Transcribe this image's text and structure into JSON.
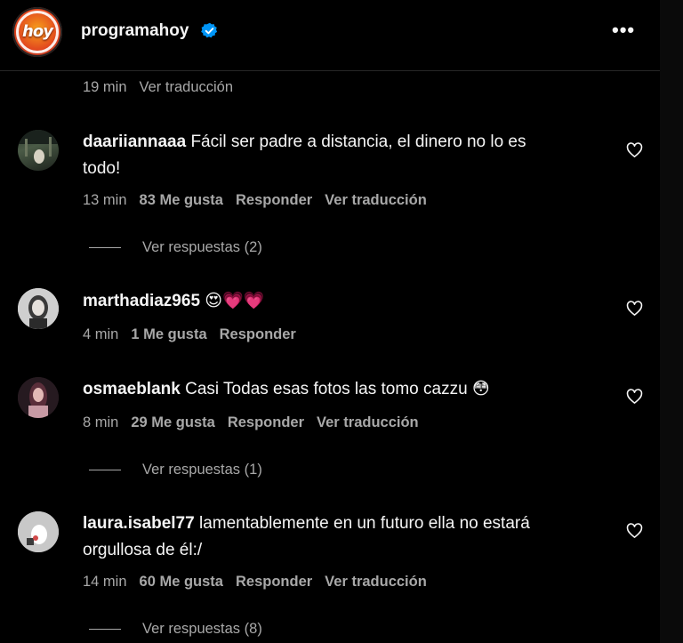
{
  "header": {
    "logo_text": "hoy",
    "username": "programahoy",
    "verified_icon": "verified-badge-icon",
    "more_icon": "more-options-icon",
    "more_label": "•••"
  },
  "top_meta": {
    "time": "19 min",
    "translate": "Ver traducción"
  },
  "comments": [
    {
      "user": "daariiannaaa",
      "text_line1": "Fácil ser padre a distancia, el dinero no lo es",
      "text_line2": "todo!",
      "time": "13 min",
      "likes": "83 Me gusta",
      "reply": "Responder",
      "translate": "Ver traducción",
      "replies": "Ver respuestas (2)"
    },
    {
      "user": "marthadiaz965",
      "text_line1": "😍💗💗",
      "time": "4 min",
      "likes": "1 Me gusta",
      "reply": "Responder"
    },
    {
      "user": "osmaeblank",
      "text_line1": "Casi Todas esas fotos las tomo cazzu 😳",
      "time": "8 min",
      "likes": "29 Me gusta",
      "reply": "Responder",
      "translate": "Ver traducción",
      "replies": "Ver respuestas (1)"
    },
    {
      "user": "laura.isabel77",
      "text_line1": "lamentablemente en un futuro ella no estará",
      "text_line2": "orgullosa de él:/",
      "time": "14 min",
      "likes": "60 Me gusta",
      "reply": "Responder",
      "translate": "Ver traducción",
      "replies": "Ver respuestas (8)"
    }
  ],
  "colors": {
    "background": "#000000",
    "primary_text": "#f5f5f5",
    "secondary_text": "#a8a8a8",
    "verified": "#0095f6"
  },
  "icons": {
    "like": "heart-outline-icon"
  }
}
